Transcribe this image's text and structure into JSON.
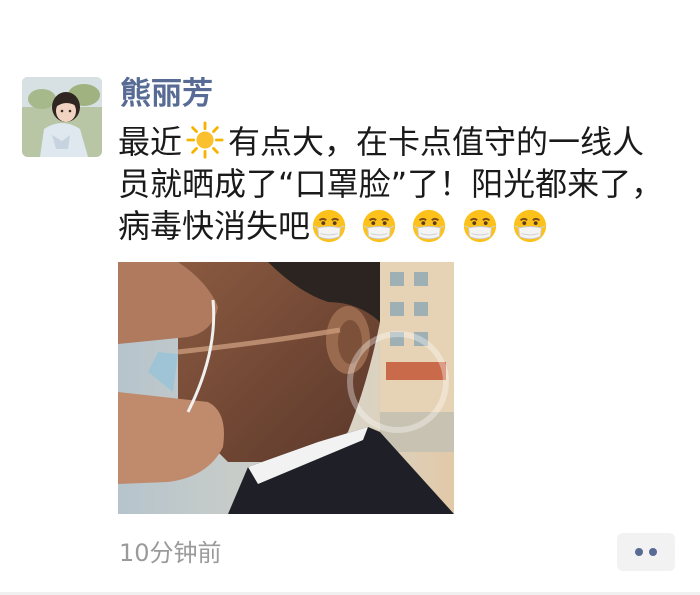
{
  "post": {
    "author": "熊丽芳",
    "text": {
      "line1_before_icon": "最近",
      "inline_icon": "sun-emoji",
      "line1_after_icon": "有点大，在卡点值守的一线人",
      "line2": "员就晒成了“口罩脸”了！阳光都来了，",
      "line3": "病毒快消失吧",
      "trailing_emoji": "mask-face-emoji",
      "trailing_emoji_count": 5
    },
    "photo_icon": "photo-mask-tan-lines",
    "timestamp": "10分钟前",
    "more_icon": "more-dots-icon"
  },
  "colors": {
    "author": "#576b95",
    "text": "#1a1a1a",
    "timestamp": "#9a9a9a",
    "more_bg": "#f2f2f2"
  }
}
